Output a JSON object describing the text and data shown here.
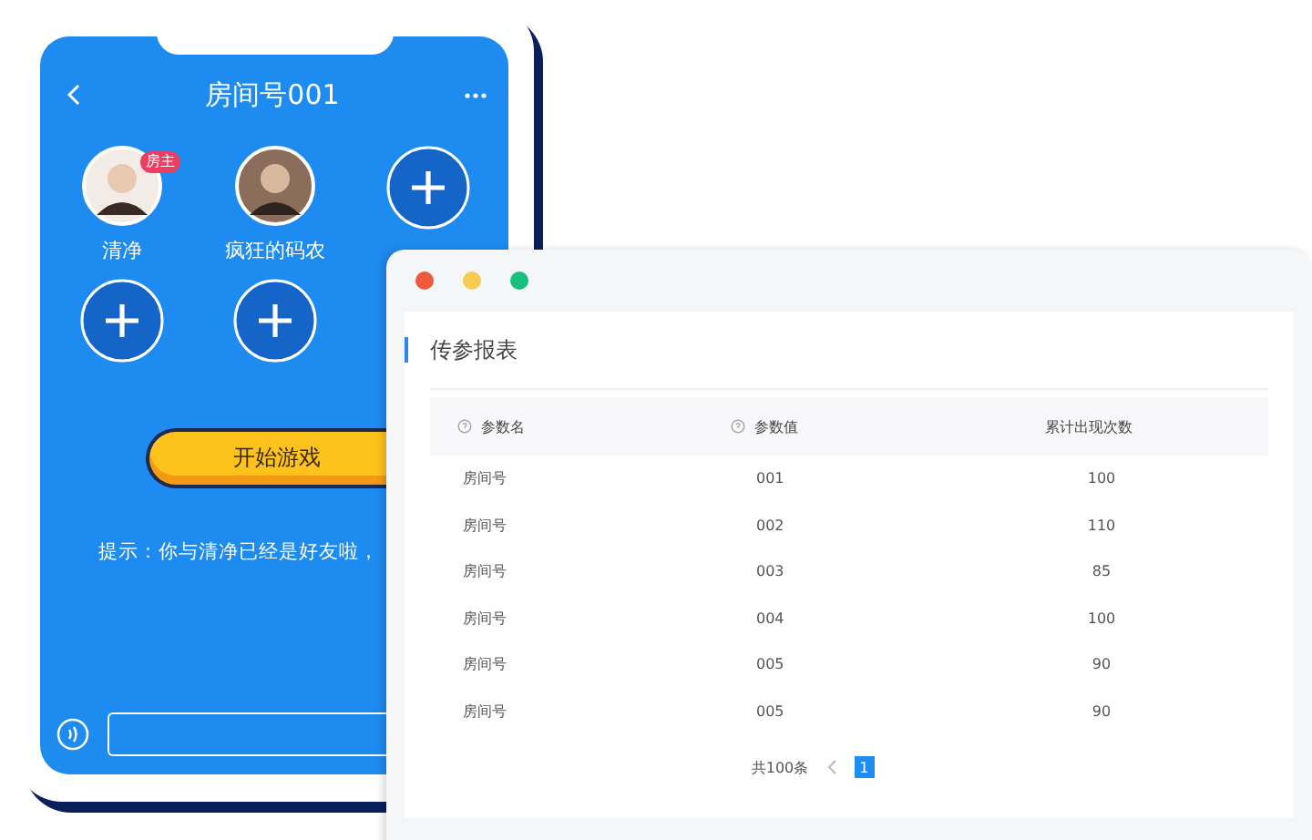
{
  "phone": {
    "title": "房间号001",
    "players": [
      {
        "kind": "player",
        "name": "清净",
        "badge": "房主"
      },
      {
        "kind": "player",
        "name": "疯狂的码农"
      },
      {
        "kind": "empty"
      },
      {
        "kind": "empty"
      },
      {
        "kind": "empty"
      }
    ],
    "start_button": "开始游戏",
    "hint": "提示：你与清净已经是好友啦，"
  },
  "window": {
    "title": "传参报表",
    "table": {
      "columns": [
        {
          "label": "参数名",
          "help": true
        },
        {
          "label": "参数值",
          "help": true
        },
        {
          "label": "累计出现次数",
          "help": false
        }
      ],
      "rows": [
        [
          "房间号",
          "001",
          "100"
        ],
        [
          "房间号",
          "002",
          "110"
        ],
        [
          "房间号",
          "003",
          "85"
        ],
        [
          "房间号",
          "004",
          "100"
        ],
        [
          "房间号",
          "005",
          "90"
        ],
        [
          "房间号",
          "005",
          "90"
        ]
      ]
    },
    "pagination": {
      "total": "共100条",
      "pages": [
        {
          "label": "1",
          "selected": true
        }
      ]
    }
  }
}
